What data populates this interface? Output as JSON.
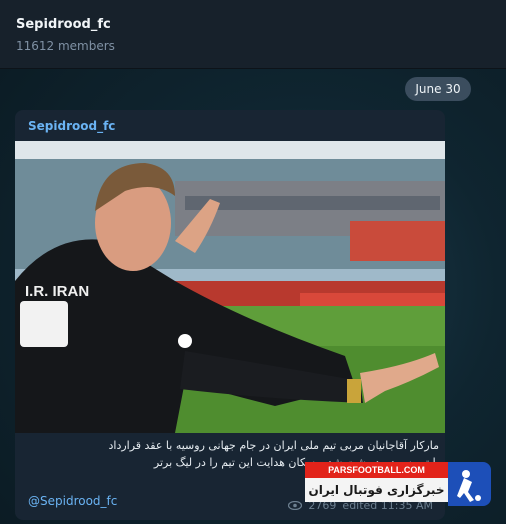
{
  "header": {
    "title": "Sepidrood_fc",
    "subtitle": "11612 members"
  },
  "date_pill": "June 30",
  "message": {
    "sender": "Sepidrood_fc",
    "caption_line1": "مارکار آقاجانیان مربی تیم ملی ایران در جام جهانی روسیه با عقد قرارداد",
    "caption_line2": "با تیم سپیدرود رشت شد و سکان هدایت این تیم را در لیگ برتر",
    "mention": "@Sepidrood_fc",
    "views": "2769",
    "edited": "edited 11:35 AM"
  },
  "photo": {
    "shirt_text": "I.R. IRAN"
  },
  "watermark": {
    "top": "PARSFOOTBALL.COM",
    "bottom": "خبرگزاری فوتبال ایران"
  },
  "colors": {
    "header_bg": "#17212b",
    "bubble_bg": "#182533",
    "sender": "#6ab3f3",
    "date_pill_bg": "#3b4d5e"
  }
}
